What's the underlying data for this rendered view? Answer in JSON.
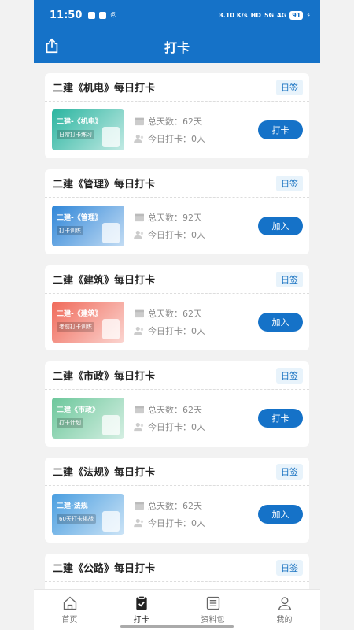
{
  "status": {
    "time": "11:50",
    "network_speed": "3.10 K/s",
    "net_badge": "HD",
    "signal1": "5G",
    "signal2": "4G",
    "battery": "91"
  },
  "header": {
    "title": "打卡",
    "share_icon": "share-icon"
  },
  "cards": [
    {
      "title": "二建《机电》每日打卡",
      "tag": "日签",
      "thumb_title": "二建-《机电》",
      "thumb_sub": "日常打卡练习",
      "thumb_color": "#2bb5a0",
      "total_label": "总天数：",
      "total_value": "62天",
      "today_label": "今日打卡：",
      "today_value": "0人",
      "button": "打卡"
    },
    {
      "title": "二建《管理》每日打卡",
      "tag": "日签",
      "thumb_title": "二建-《管理》",
      "thumb_sub": "打卡训练",
      "thumb_color": "#2f86d8",
      "total_label": "总天数：",
      "total_value": "92天",
      "today_label": "今日打卡：",
      "today_value": "0人",
      "button": "加入"
    },
    {
      "title": "二建《建筑》每日打卡",
      "tag": "日签",
      "thumb_title": "二建-《建筑》",
      "thumb_sub": "考前打卡训练",
      "thumb_color": "#f06a5a",
      "total_label": "总天数：",
      "total_value": "62天",
      "today_label": "今日打卡：",
      "today_value": "0人",
      "button": "加入"
    },
    {
      "title": "二建《市政》每日打卡",
      "tag": "日签",
      "thumb_title": "二建《市政》",
      "thumb_sub": "打卡计划",
      "thumb_color": "#6cc79b",
      "total_label": "总天数：",
      "total_value": "62天",
      "today_label": "今日打卡：",
      "today_value": "0人",
      "button": "打卡"
    },
    {
      "title": "二建《法规》每日打卡",
      "tag": "日签",
      "thumb_title": "二建-法规",
      "thumb_sub": "60天打卡挑战",
      "thumb_color": "#4a9ee0",
      "total_label": "总天数：",
      "total_value": "62天",
      "today_label": "今日打卡：",
      "today_value": "0人",
      "button": "加入"
    },
    {
      "title": "二建《公路》每日打卡",
      "tag": "日签",
      "thumb_title": "",
      "thumb_sub": "",
      "thumb_color": "#4a9ee0",
      "total_label": "",
      "total_value": "",
      "today_label": "",
      "today_value": "",
      "button": ""
    }
  ],
  "tabs": [
    {
      "label": "首页",
      "icon": "home-icon"
    },
    {
      "label": "打卡",
      "icon": "checkin-icon"
    },
    {
      "label": "资料包",
      "icon": "document-list-icon"
    },
    {
      "label": "我的",
      "icon": "user-icon"
    }
  ]
}
